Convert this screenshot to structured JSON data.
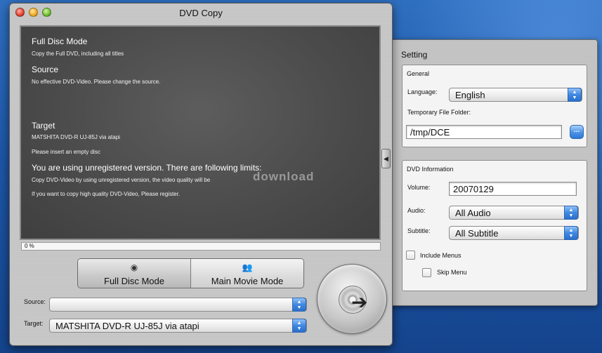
{
  "window": {
    "title": "DVD Copy"
  },
  "screen": {
    "mode_heading": "Full Disc Mode",
    "mode_desc": "Copy the Full DVD, including all titles",
    "source_heading": "Source",
    "source_desc": "No effective DVD-Video. Please change the source.",
    "target_heading": "Target",
    "target_device": "MATSHITA DVD-R   UJ-85J via atapi",
    "target_desc": "Please insert an empty disc",
    "warning_heading": "You are using unregistered version. There are following limits:",
    "warning_line1": "Copy DVD-Video by using unregistered version, the video quality will be",
    "warning_line2": "If you want to copy high quality DVD-Video, Please register.",
    "watermark": "download"
  },
  "progress": {
    "label": "0 %",
    "value": 0
  },
  "modes": {
    "full_disc": "Full Disc Mode",
    "main_movie": "Main Movie Mode"
  },
  "source": {
    "label": "Source:",
    "value": ""
  },
  "target": {
    "label": "Target:",
    "value": "MATSHITA DVD-R   UJ-85J via atapi"
  },
  "settings": {
    "title": "Setting",
    "general": {
      "title": "General",
      "language_label": "Language:",
      "language_value": "English",
      "temp_folder_label": "Temporary File Folder:",
      "temp_folder_value": "/tmp/DCE",
      "browse_label": "..."
    },
    "dvd_info": {
      "title": "DVD Information",
      "volume_label": "Volume:",
      "volume_value": "20070129",
      "audio_label": "Audio:",
      "audio_value": "All Audio",
      "subtitle_label": "Subtitle:",
      "subtitle_value": "All Subtitle",
      "include_menus_label": "Include Menus",
      "skip_menu_label": "Skip Menu"
    }
  },
  "icons": [
    "close-icon",
    "minimize-icon",
    "zoom-icon",
    "disc-icon",
    "users-icon",
    "burn-disc-icon",
    "arrow-right-icon",
    "drawer-toggle-icon",
    "popup-arrows-icon"
  ]
}
